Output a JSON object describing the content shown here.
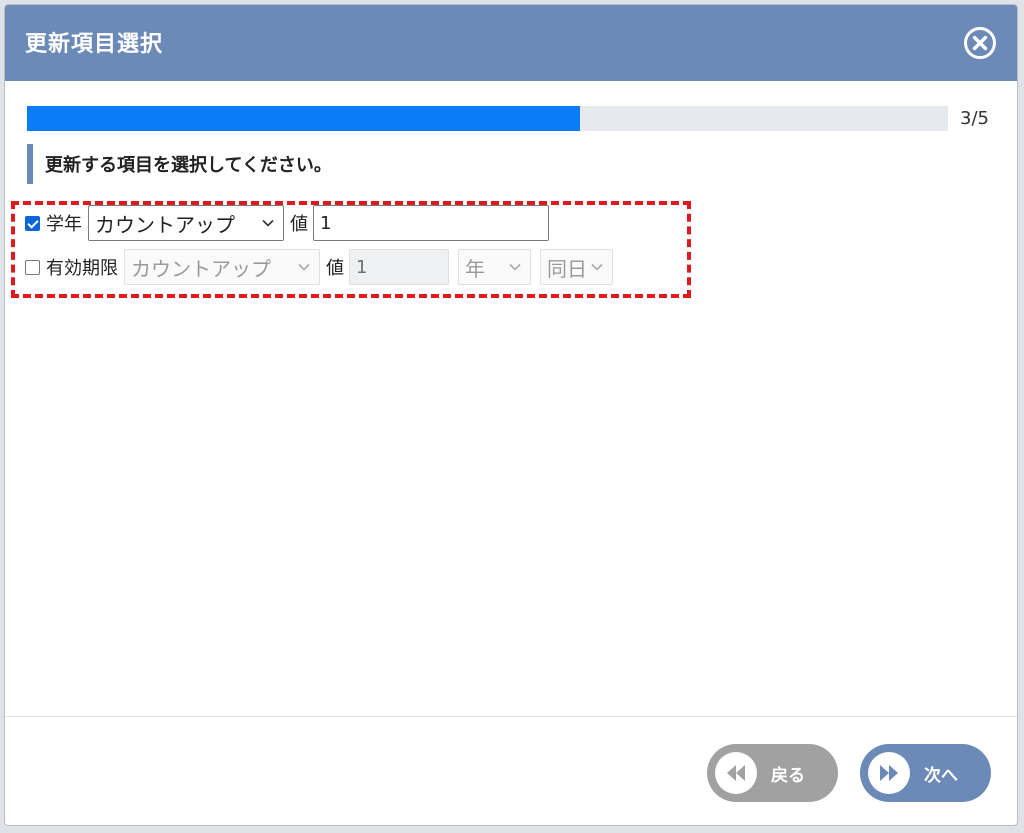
{
  "dialog": {
    "title": "更新項目選択",
    "close_icon": "close-circle-icon"
  },
  "progress": {
    "text": "3/5",
    "fraction": 0.6
  },
  "instruction": "更新する項目を選択してください。",
  "rows": [
    {
      "checked": true,
      "label": "学年",
      "mode": "カウントアップ",
      "value_label": "値",
      "value": "1"
    },
    {
      "checked": false,
      "label": "有効期限",
      "mode": "カウントアップ",
      "value_label": "値",
      "value": "1",
      "unit": "年",
      "day": "同日"
    }
  ],
  "footer": {
    "back_label": "戻る",
    "next_label": "次へ",
    "back_icon": "rewind-icon",
    "next_icon": "fast-forward-icon"
  },
  "colors": {
    "header": "#6c8ab7",
    "progress_fill": "#0a7cf7",
    "highlight": "#e0191f",
    "back_button": "#a1a1a1",
    "next_button": "#6c8ab7"
  }
}
